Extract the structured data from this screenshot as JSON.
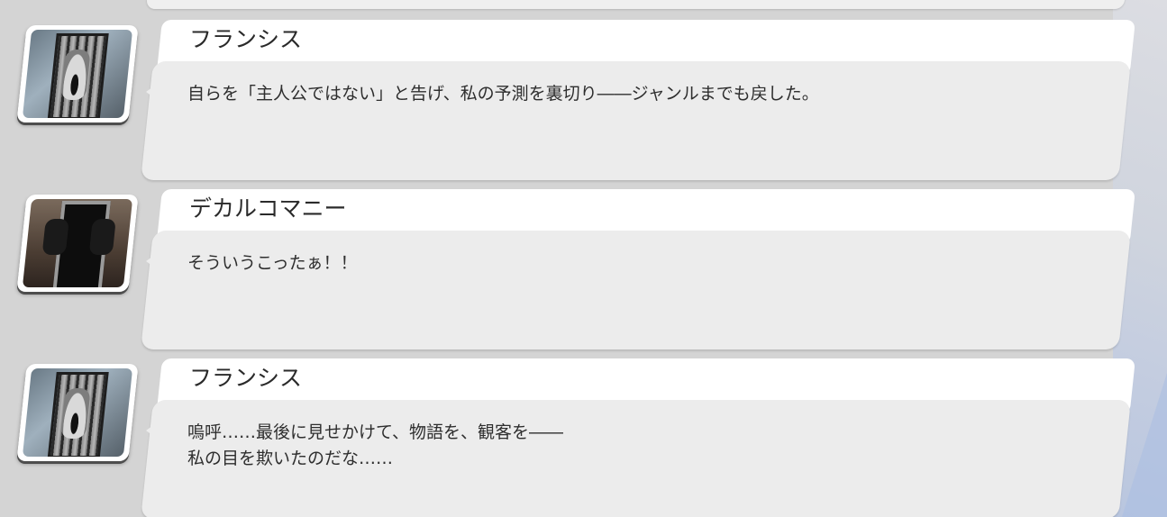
{
  "log": {
    "entries": [
      {
        "speaker": "フランシス",
        "portrait": "francis-portrait",
        "lines": [
          "自らを「主人公ではない」と告げ、私の予測を裏切り――ジャンルまでも戻した。"
        ]
      },
      {
        "speaker": "デカルコマニー",
        "portrait": "decalcomanie-portrait",
        "lines": [
          "そういうこったぁ！！"
        ]
      },
      {
        "speaker": "フランシス",
        "portrait": "francis-portrait",
        "lines": [
          "嗚呼……最後に見せかけて、物語を、観客を――",
          "私の目を欺いたのだな……"
        ]
      }
    ]
  },
  "colors": {
    "background": "#d4d4d4",
    "name_panel": "#ffffff",
    "text_panel": "#ececec",
    "text": "#2b2b2b"
  }
}
